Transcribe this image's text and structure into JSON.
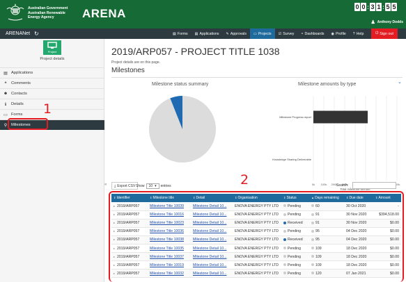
{
  "header": {
    "gov_line1": "Australian Government",
    "gov_line2": "Australian Renewable",
    "gov_line3": "Energy Agency",
    "logo_text": "ARENA",
    "clock": [
      "0",
      "0",
      ":",
      "3",
      "1",
      ":",
      "5",
      "5"
    ],
    "user_name": "Anthony Dodds"
  },
  "nav": {
    "brand": "ARENANet",
    "items": [
      {
        "label": "Forms",
        "icon": "forms-icon",
        "glyph": "▤"
      },
      {
        "label": "Applications",
        "icon": "applications-icon",
        "glyph": "▤"
      },
      {
        "label": "Approvals",
        "icon": "approvals-icon",
        "glyph": "✎"
      },
      {
        "label": "Projects",
        "icon": "projects-icon",
        "glyph": "▭",
        "active": true
      },
      {
        "label": "Survey",
        "icon": "survey-icon",
        "glyph": "☑"
      },
      {
        "label": "Dashboards",
        "icon": "dashboards-icon",
        "glyph": "◓"
      },
      {
        "label": "Profile",
        "icon": "profile-icon",
        "glyph": "◉"
      },
      {
        "label": "Help",
        "icon": "help-icon",
        "glyph": "?"
      }
    ],
    "signout": "Sign out"
  },
  "sidebar": {
    "tile_label": "Project",
    "project_details": "Project details",
    "items": [
      {
        "label": "Applications",
        "icon": "applications-icon",
        "glyph": "▤"
      },
      {
        "label": "Comments",
        "icon": "comments-icon",
        "glyph": "❝"
      },
      {
        "label": "Contacts",
        "icon": "contacts-icon",
        "glyph": "☻"
      },
      {
        "label": "Details",
        "icon": "info-icon",
        "glyph": "ℹ"
      },
      {
        "label": "Forms",
        "icon": "forms-icon",
        "glyph": "▭"
      },
      {
        "label": "Milestones",
        "icon": "pin-icon",
        "glyph": "⚲",
        "active": true
      }
    ]
  },
  "annotations": {
    "one": "1",
    "two": "2"
  },
  "main": {
    "title": "2019/ARP057 - PROJECT TITLE 1038",
    "subtitle": "Project details are on this page.",
    "section": "Milestones"
  },
  "charts": {
    "pie_title": "Milestone status summary",
    "bar_title": "Milestone amounts by type"
  },
  "chart_data": [
    {
      "type": "pie",
      "title": "Milestone status summary",
      "labels": [
        "Pending",
        "Received"
      ],
      "values": [
        94,
        6
      ],
      "colors": [
        "#dcdcdc",
        "#1f6ab0"
      ],
      "legend": "bottom"
    },
    {
      "type": "bar",
      "orientation": "horizontal",
      "title": "Milestone amounts by type",
      "categories": [
        "Milestone Progress report",
        "Knowledge Sharing Deliverable"
      ],
      "series": [
        {
          "name": "Paid",
          "color": "#2fa84f",
          "values": [
            0,
            0
          ]
        },
        {
          "name": "Unpaid",
          "color": "#333333",
          "values": [
            5.2,
            0
          ]
        }
      ],
      "stacked": true,
      "xlabel": "Total milestone amount",
      "xticks": [
        "0k",
        "100k",
        "200k",
        "300k",
        "400k",
        "500k",
        "600k",
        "700k",
        "800k"
      ],
      "xlim": [
        0,
        8
      ],
      "legend": "bottom"
    }
  ],
  "controls": {
    "export": "Export CSV",
    "show": "Show",
    "show_value": "10",
    "entries": "entries",
    "search": "Search:"
  },
  "table": {
    "columns": [
      "Identifier",
      "Milestone title",
      "Detail",
      "Organisation",
      "Status",
      "Days remaining",
      "Due date",
      "Amount"
    ],
    "rows": [
      {
        "id": "2019/ARP057",
        "title": "Milestone Title 10039",
        "detail": "Milestone Detail 10...",
        "org": "ENOVA ENERGY PTY LTD",
        "status": "Pending",
        "days": "60",
        "due": "30 Oct 2020",
        "amount": "-"
      },
      {
        "id": "2019/ARP057",
        "title": "Milestone Title 10016",
        "detail": "Milestone Detail 10...",
        "org": "ENOVA ENERGY PTY LTD",
        "status": "Pending",
        "days": "91",
        "due": "30 Nov 2020",
        "amount": "$394,518.00"
      },
      {
        "id": "2019/ARP057",
        "title": "Milestone Title 10023",
        "detail": "Milestone Detail 10...",
        "org": "ENOVA ENERGY PTY LTD",
        "status": "Received",
        "days": "91",
        "due": "30 Nov 2020",
        "amount": "$0.00"
      },
      {
        "id": "2019/ARP057",
        "title": "Milestone Title 10036",
        "detail": "Milestone Detail 10...",
        "org": "ENOVA ENERGY PTY LTD",
        "status": "Pending",
        "days": "95",
        "due": "04 Dec 2020",
        "amount": "$0.00"
      },
      {
        "id": "2019/ARP057",
        "title": "Milestone Title 10038",
        "detail": "Milestone Detail 10...",
        "org": "ENOVA ENERGY PTY LTD",
        "status": "Received",
        "days": "95",
        "due": "04 Dec 2020",
        "amount": "$0.00"
      },
      {
        "id": "2019/ARP057",
        "title": "Milestone Title 10035",
        "detail": "Milestone Detail 10...",
        "org": "ENOVA ENERGY PTY LTD",
        "status": "Pending",
        "days": "109",
        "due": "18 Dec 2020",
        "amount": "$0.00"
      },
      {
        "id": "2019/ARP057",
        "title": "Milestone Title 10037",
        "detail": "Milestone Detail 10...",
        "org": "ENOVA ENERGY PTY LTD",
        "status": "Pending",
        "days": "109",
        "due": "18 Dec 2020",
        "amount": "$0.00"
      },
      {
        "id": "2019/ARP057",
        "title": "Milestone Title 10019",
        "detail": "Milestone Detail 10...",
        "org": "ENOVA ENERGY PTY LTD",
        "status": "Pending",
        "days": "109",
        "due": "18 Dec 2020",
        "amount": "$0.00"
      },
      {
        "id": "2019/ARP057",
        "title": "Milestone Title 10032",
        "detail": "Milestone Detail 10...",
        "org": "ENOVA ENERGY PTY LTD",
        "status": "Pending",
        "days": "120",
        "due": "07 Jan 2021",
        "amount": "$0.00"
      }
    ]
  },
  "colors": {
    "header_green": "#156a36",
    "nav_dark": "#2d3a40",
    "table_header": "#1f6a9c",
    "signout_red": "#e31b23",
    "received_blue": "#1f6ab0",
    "pending_grey": "#cccccc"
  }
}
